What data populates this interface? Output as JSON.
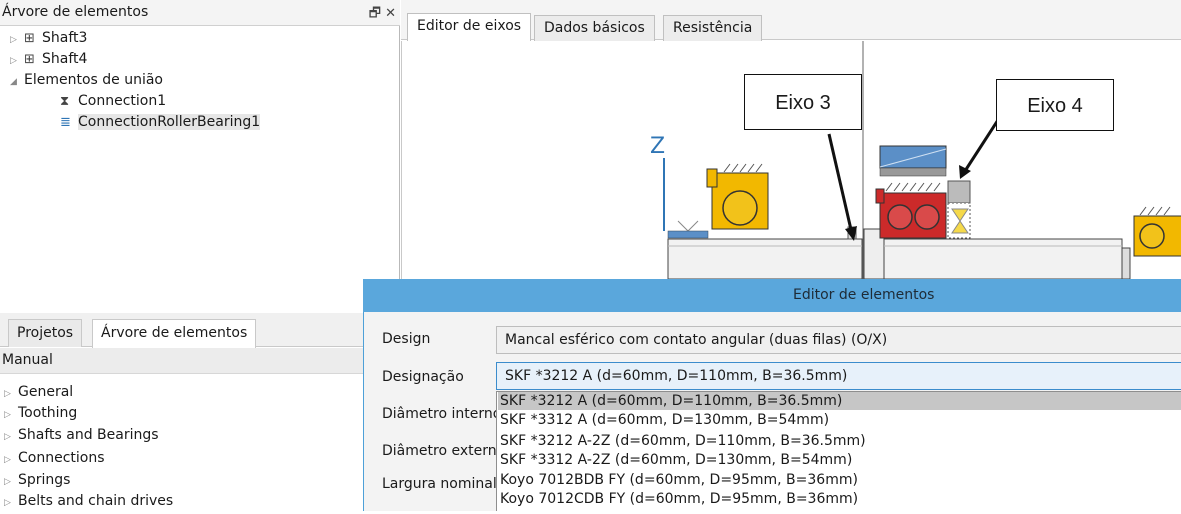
{
  "tree_panel": {
    "title": "Árvore de elementos",
    "pin_icon": "pin-icon",
    "close_icon": "close-icon",
    "items": [
      {
        "label": "Shaft3",
        "icon": "shaft-icon",
        "expanded": false
      },
      {
        "label": "Shaft4",
        "icon": "shaft-icon",
        "expanded": false
      },
      {
        "label": "Elementos de união",
        "expanded": true
      },
      {
        "label": "Connection1",
        "icon": "connection-icon"
      },
      {
        "label": "ConnectionRollerBearing1",
        "icon": "bearing-connection-icon"
      }
    ]
  },
  "bottom_panel": {
    "tabs": [
      "Projetos",
      "Árvore de elementos"
    ],
    "active_tab": "Árvore de elementos",
    "header": "Manual",
    "categories": [
      "General",
      "Toothing",
      "Shafts and Bearings",
      "Connections",
      "Springs",
      "Belts and chain drives"
    ]
  },
  "editor_tabs": [
    "Editor de eixos",
    "Dados básicos",
    "Resistência"
  ],
  "canvas": {
    "axis_label": "Z",
    "callouts": [
      "Eixo 3",
      "Eixo 4"
    ]
  },
  "dialog": {
    "title": "Editor de elementos",
    "fields": [
      {
        "label": "Design",
        "value": "Mancal esférico com contato angular (duas filas) (O/X)"
      },
      {
        "label": "Designação",
        "value": "SKF *3212 A (d=60mm, D=110mm, B=36.5mm)"
      },
      {
        "label": "Diâmetro interno"
      },
      {
        "label": "Diâmetro externo"
      },
      {
        "label": "Largura nominal"
      }
    ],
    "options": [
      "SKF *3212 A (d=60mm, D=110mm, B=36.5mm)",
      "SKF *3312 A (d=60mm, D=130mm, B=54mm)",
      "SKF *3212 A-2Z (d=60mm, D=110mm, B=36.5mm)",
      "SKF *3312 A-2Z (d=60mm, D=130mm, B=54mm)",
      "Koyo 7012BDB FY (d=60mm, D=95mm, B=36mm)",
      "Koyo 7012CDB FY (d=60mm, D=95mm, B=36mm)"
    ],
    "highlighted_option": 0
  },
  "colors": {
    "dialog_title": "#5aa7dc",
    "bearing_yellow": "#f2b800",
    "bearing_red": "#cc2a2a",
    "shaft_blue": "#2f75b5"
  }
}
